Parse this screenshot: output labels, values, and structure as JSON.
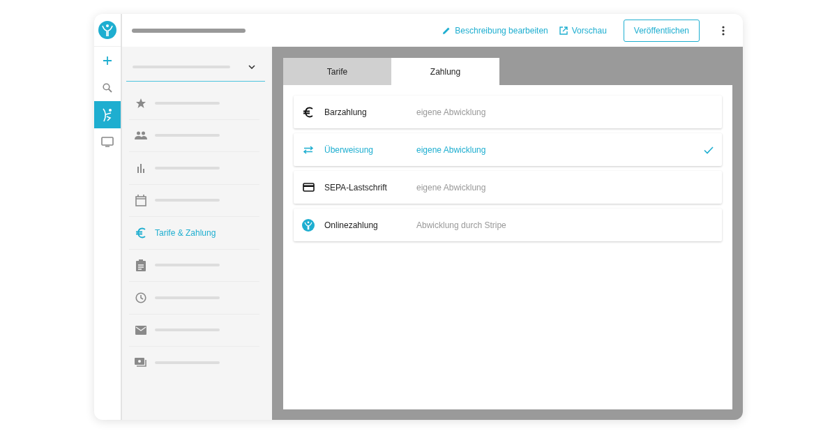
{
  "rail": [
    {
      "selected": false
    },
    {
      "selected": false
    },
    {
      "selected": true
    },
    {
      "selected": false
    }
  ],
  "top_bar": {
    "links": [
      "Beschreibung bearbeiten",
      "Vorschau"
    ],
    "publish_button": "Veröffentlichen"
  },
  "sidebar": {
    "items": [
      {
        "selected": false
      },
      {
        "selected": false
      },
      {
        "selected": false
      },
      {
        "selected": false
      },
      {
        "label": "Tarife & Zahlung",
        "selected": true
      },
      {
        "selected": false
      },
      {
        "selected": false
      },
      {
        "selected": false
      },
      {
        "selected": false
      }
    ]
  },
  "tabs": [
    {
      "label": "Tarife",
      "selected": false
    },
    {
      "label": "Zahlung",
      "selected": true
    }
  ],
  "payment_methods": [
    {
      "name": "Barzahlung",
      "note": "eigene Abwicklung",
      "selected": false
    },
    {
      "name": "Überweisung",
      "note": "eigene Abwicklung",
      "selected": true
    },
    {
      "name": "SEPA-Lastschrift",
      "note": "eigene Abwicklung",
      "selected": false
    },
    {
      "name": "Onlinezahlung",
      "note": "Abwicklung durch Stripe",
      "selected": false
    }
  ]
}
